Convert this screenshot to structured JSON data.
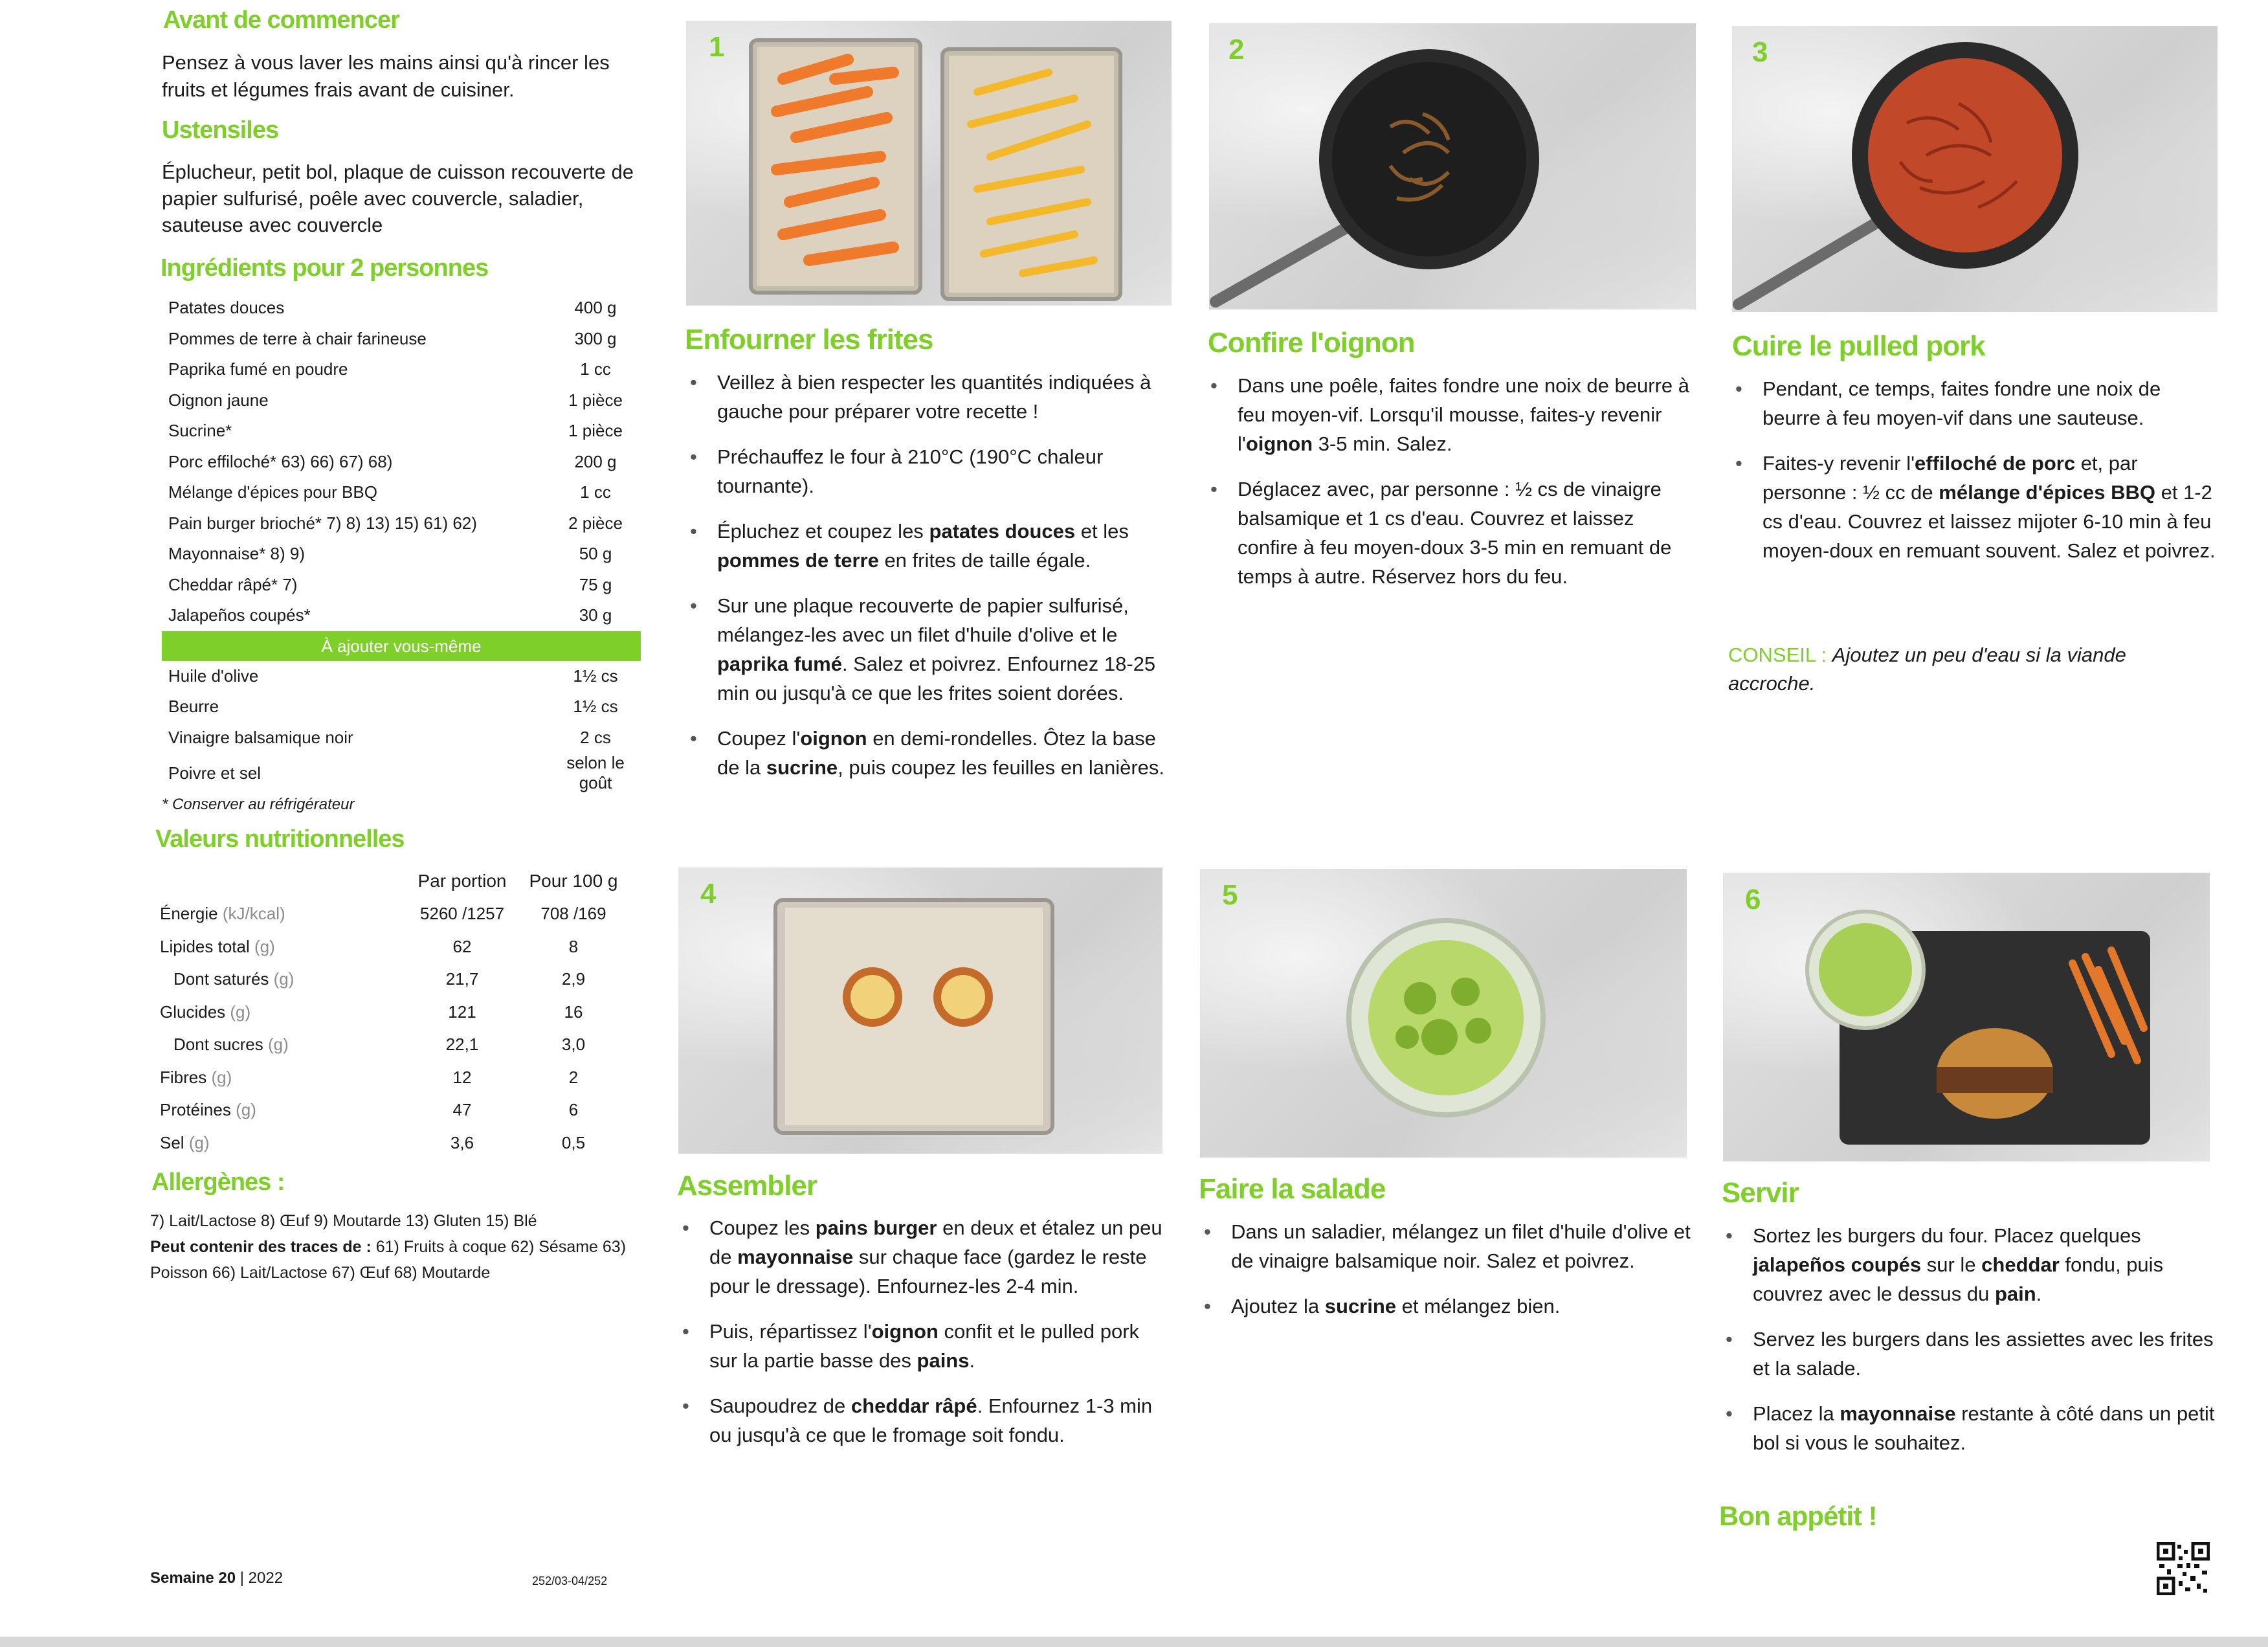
{
  "left": {
    "before_title": "Avant de commencer",
    "before_text": "Pensez à vous laver les mains ainsi qu'à rincer les fruits et légumes frais avant de cuisiner.",
    "utensils_title": "Ustensiles",
    "utensils_text": "Éplucheur, petit bol, plaque de cuisson recouverte de papier sulfurisé, poêle avec couvercle, saladier, sauteuse avec couvercle",
    "ingredients_title": "Ingrédients pour 2 personnes",
    "ingredients": [
      {
        "name": "Patates douces",
        "qty": "400 g"
      },
      {
        "name": "Pommes de terre à chair farineuse",
        "qty": "300 g"
      },
      {
        "name": "Paprika fumé en poudre",
        "qty": "1 cc"
      },
      {
        "name": "Oignon jaune",
        "qty": "1 pièce"
      },
      {
        "name": "Sucrine*",
        "qty": "1 pièce"
      },
      {
        "name": "Porc effiloché* 63) 66) 67) 68)",
        "qty": "200 g"
      },
      {
        "name": "Mélange d'épices pour BBQ",
        "qty": "1 cc"
      },
      {
        "name": "Pain burger brioché* 7) 8) 13) 15) 61) 62)",
        "qty": "2 pièce"
      },
      {
        "name": "Mayonnaise* 8) 9)",
        "qty": "50 g"
      },
      {
        "name": "Cheddar râpé* 7)",
        "qty": "75 g"
      },
      {
        "name": "Jalapeños coupés*",
        "qty": "30 g"
      }
    ],
    "add_yourself_banner": "À ajouter vous-même",
    "extra_ingredients": [
      {
        "name": "Huile d'olive",
        "qty": "1½ cs"
      },
      {
        "name": "Beurre",
        "qty": "1½ cs"
      },
      {
        "name": "Vinaigre balsamique noir",
        "qty": "2 cs"
      },
      {
        "name": "Poivre et sel",
        "qty": "selon le goût"
      }
    ],
    "fridge_note": "* Conserver au réfrigérateur",
    "nutrition_title": "Valeurs nutritionnelles",
    "nutrition_header": {
      "per_portion": "Par portion",
      "per_100g": "Pour 100 g"
    },
    "nutrition": [
      {
        "name": "Énergie",
        "unit": "(kJ/kcal)",
        "portion": "5260 /1257",
        "per100": "708 /169",
        "indent": false
      },
      {
        "name": "Lipides total",
        "unit": "(g)",
        "portion": "62",
        "per100": "8",
        "indent": false
      },
      {
        "name": "Dont saturés",
        "unit": "(g)",
        "portion": "21,7",
        "per100": "2,9",
        "indent": true
      },
      {
        "name": "Glucides",
        "unit": "(g)",
        "portion": "121",
        "per100": "16",
        "indent": false
      },
      {
        "name": "Dont sucres",
        "unit": "(g)",
        "portion": "22,1",
        "per100": "3,0",
        "indent": true
      },
      {
        "name": "Fibres",
        "unit": "(g)",
        "portion": "12",
        "per100": "2",
        "indent": false
      },
      {
        "name": "Protéines",
        "unit": "(g)",
        "portion": "47",
        "per100": "6",
        "indent": false
      },
      {
        "name": "Sel",
        "unit": "(g)",
        "portion": "3,6",
        "per100": "0,5",
        "indent": false
      }
    ],
    "allergens_title": "Allergènes :",
    "allergens_line1": "7) Lait/Lactose 8) Œuf 9) Moutarde 13) Gluten 15) Blé",
    "allergens_traces_label": "Peut contenir des traces de :",
    "allergens_traces": "61) Fruits à coque 62) Sésame 63) Poisson 66) Lait/Lactose 67) Œuf 68) Moutarde",
    "week_label": "Semaine 20",
    "year": "2022",
    "code": "252/03-04/252"
  },
  "steps": [
    {
      "num": "1",
      "title": "Enfourner les frites",
      "bullets": [
        "Veillez à bien respecter les quantités indiquées à gauche pour préparer votre recette !",
        "Préchauffez le four à 210°C (190°C chaleur tournante).",
        "Épluchez et coupez les <b>patates douces</b> et les <b>pommes de terre</b> en frites de taille égale.",
        "Sur une plaque recouverte de papier sulfurisé, mélangez-les avec un filet d'huile d'olive et le <b>paprika fumé</b>. Salez et poivrez. Enfournez 18-25 min ou jusqu'à ce que les frites soient dorées.",
        "Coupez l'<b>oignon</b> en demi-rondelles. Ôtez la base de la <b>sucrine</b>, puis coupez les feuilles en lanières."
      ]
    },
    {
      "num": "2",
      "title": "Confire l'oignon",
      "bullets": [
        "Dans une poêle, faites fondre une noix de beurre à feu moyen-vif. Lorsqu'il mousse, faites-y revenir l'<b>oignon</b> 3-5 min. Salez.",
        "Déglacez avec, par personne : ½ cs de vinaigre balsamique et 1 cs d'eau. Couvrez et laissez confire à feu moyen-doux 3-5 min en remuant de temps à autre. Réservez hors du feu."
      ]
    },
    {
      "num": "3",
      "title": "Cuire le pulled pork",
      "bullets": [
        "Pendant, ce temps, faites fondre une noix de beurre à feu moyen-vif dans une sauteuse.",
        "Faites-y revenir l'<b>effiloché de porc</b> et, par personne : ½ cc de <b>mélange d'épices BBQ</b> et 1-2 cs d'eau. Couvrez et laissez mijoter 6-10 min à feu moyen-doux en remuant souvent. Salez et poivrez."
      ],
      "tip_label": "CONSEIL :",
      "tip_text": "Ajoutez un peu d'eau si la viande accroche."
    },
    {
      "num": "4",
      "title": "Assembler",
      "bullets": [
        "Coupez les <b>pains burger</b> en deux et étalez un peu de <b>mayonnaise</b> sur chaque face (gardez le reste pour le dressage). Enfournez-les 2-4 min.",
        "Puis, répartissez l'<b>oignon</b> confit et le pulled pork sur la partie basse des <b>pains</b>.",
        "Saupoudrez de <b>cheddar râpé</b>. Enfournez 1-3 min ou jusqu'à ce que le fromage soit fondu."
      ]
    },
    {
      "num": "5",
      "title": "Faire la salade",
      "bullets": [
        "Dans un saladier, mélangez un filet d'huile d'olive et de vinaigre balsamique noir. Salez et poivrez.",
        "Ajoutez la <b>sucrine</b> et mélangez bien."
      ]
    },
    {
      "num": "6",
      "title": "Servir",
      "bullets": [
        "Sortez les burgers du four. Placez quelques <b>jalapeños coupés</b> sur le <b>cheddar</b> fondu, puis couvrez avec le dessus du <b>pain</b>.",
        "Servez les burgers dans les assiettes avec les frites et la salade.",
        "Placez la <b>mayonnaise</b> restante à côté dans un petit bol si vous le souhaitez."
      ],
      "closing": "Bon appétit !"
    }
  ],
  "colors": {
    "accent": "#7fcf2a"
  },
  "icons": {
    "qr": "qr-code-icon"
  }
}
